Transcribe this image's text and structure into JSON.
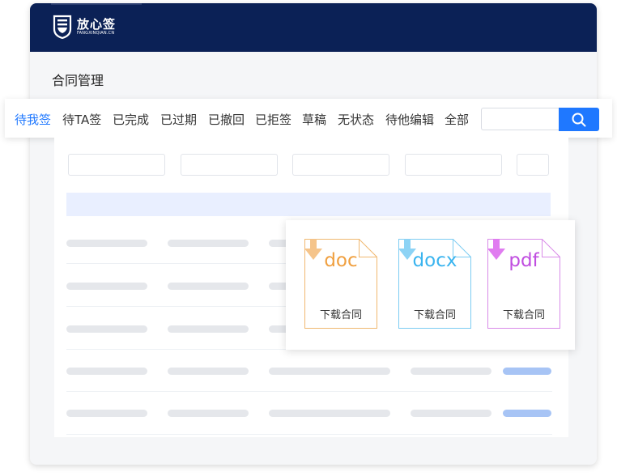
{
  "brand": {
    "name_cn": "放心签",
    "name_en": "FANGXINQIAN.CN"
  },
  "page_title": "合同管理",
  "tabs": [
    {
      "label": "待我签",
      "active": true
    },
    {
      "label": "待TA签"
    },
    {
      "label": "已完成"
    },
    {
      "label": "已过期"
    },
    {
      "label": "已撤回"
    },
    {
      "label": "已拒签"
    },
    {
      "label": "草稿"
    },
    {
      "label": "无状态"
    },
    {
      "label": "待他编辑"
    },
    {
      "label": "全部"
    }
  ],
  "search": {
    "placeholder": "",
    "icon": "search-icon"
  },
  "downloads": [
    {
      "ext": "doc",
      "label": "下载合同",
      "color": "#f0a040",
      "arrow": "#f5c48a"
    },
    {
      "ext": "docx",
      "label": "下载合同",
      "color": "#3ab4ef",
      "arrow": "#8dd3f5"
    },
    {
      "ext": "pdf",
      "label": "下载合同",
      "color": "#c04ee0",
      "arrow": "#e07cf0"
    }
  ],
  "colors": {
    "header": "#0b2156",
    "accent": "#1f78ff",
    "table_head": "#e9efff"
  }
}
